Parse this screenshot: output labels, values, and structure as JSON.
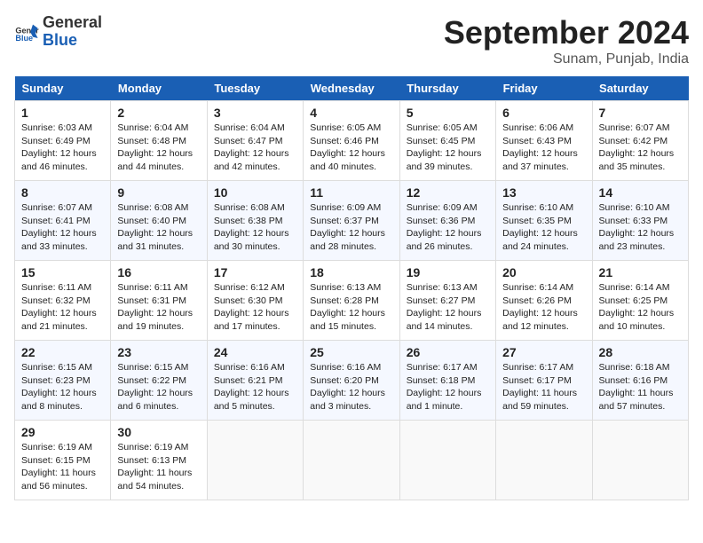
{
  "header": {
    "logo_line1": "General",
    "logo_line2": "Blue",
    "month": "September 2024",
    "location": "Sunam, Punjab, India"
  },
  "columns": [
    "Sunday",
    "Monday",
    "Tuesday",
    "Wednesday",
    "Thursday",
    "Friday",
    "Saturday"
  ],
  "weeks": [
    [
      {
        "day": "1",
        "info": "Sunrise: 6:03 AM\nSunset: 6:49 PM\nDaylight: 12 hours\nand 46 minutes."
      },
      {
        "day": "2",
        "info": "Sunrise: 6:04 AM\nSunset: 6:48 PM\nDaylight: 12 hours\nand 44 minutes."
      },
      {
        "day": "3",
        "info": "Sunrise: 6:04 AM\nSunset: 6:47 PM\nDaylight: 12 hours\nand 42 minutes."
      },
      {
        "day": "4",
        "info": "Sunrise: 6:05 AM\nSunset: 6:46 PM\nDaylight: 12 hours\nand 40 minutes."
      },
      {
        "day": "5",
        "info": "Sunrise: 6:05 AM\nSunset: 6:45 PM\nDaylight: 12 hours\nand 39 minutes."
      },
      {
        "day": "6",
        "info": "Sunrise: 6:06 AM\nSunset: 6:43 PM\nDaylight: 12 hours\nand 37 minutes."
      },
      {
        "day": "7",
        "info": "Sunrise: 6:07 AM\nSunset: 6:42 PM\nDaylight: 12 hours\nand 35 minutes."
      }
    ],
    [
      {
        "day": "8",
        "info": "Sunrise: 6:07 AM\nSunset: 6:41 PM\nDaylight: 12 hours\nand 33 minutes."
      },
      {
        "day": "9",
        "info": "Sunrise: 6:08 AM\nSunset: 6:40 PM\nDaylight: 12 hours\nand 31 minutes."
      },
      {
        "day": "10",
        "info": "Sunrise: 6:08 AM\nSunset: 6:38 PM\nDaylight: 12 hours\nand 30 minutes."
      },
      {
        "day": "11",
        "info": "Sunrise: 6:09 AM\nSunset: 6:37 PM\nDaylight: 12 hours\nand 28 minutes."
      },
      {
        "day": "12",
        "info": "Sunrise: 6:09 AM\nSunset: 6:36 PM\nDaylight: 12 hours\nand 26 minutes."
      },
      {
        "day": "13",
        "info": "Sunrise: 6:10 AM\nSunset: 6:35 PM\nDaylight: 12 hours\nand 24 minutes."
      },
      {
        "day": "14",
        "info": "Sunrise: 6:10 AM\nSunset: 6:33 PM\nDaylight: 12 hours\nand 23 minutes."
      }
    ],
    [
      {
        "day": "15",
        "info": "Sunrise: 6:11 AM\nSunset: 6:32 PM\nDaylight: 12 hours\nand 21 minutes."
      },
      {
        "day": "16",
        "info": "Sunrise: 6:11 AM\nSunset: 6:31 PM\nDaylight: 12 hours\nand 19 minutes."
      },
      {
        "day": "17",
        "info": "Sunrise: 6:12 AM\nSunset: 6:30 PM\nDaylight: 12 hours\nand 17 minutes."
      },
      {
        "day": "18",
        "info": "Sunrise: 6:13 AM\nSunset: 6:28 PM\nDaylight: 12 hours\nand 15 minutes."
      },
      {
        "day": "19",
        "info": "Sunrise: 6:13 AM\nSunset: 6:27 PM\nDaylight: 12 hours\nand 14 minutes."
      },
      {
        "day": "20",
        "info": "Sunrise: 6:14 AM\nSunset: 6:26 PM\nDaylight: 12 hours\nand 12 minutes."
      },
      {
        "day": "21",
        "info": "Sunrise: 6:14 AM\nSunset: 6:25 PM\nDaylight: 12 hours\nand 10 minutes."
      }
    ],
    [
      {
        "day": "22",
        "info": "Sunrise: 6:15 AM\nSunset: 6:23 PM\nDaylight: 12 hours\nand 8 minutes."
      },
      {
        "day": "23",
        "info": "Sunrise: 6:15 AM\nSunset: 6:22 PM\nDaylight: 12 hours\nand 6 minutes."
      },
      {
        "day": "24",
        "info": "Sunrise: 6:16 AM\nSunset: 6:21 PM\nDaylight: 12 hours\nand 5 minutes."
      },
      {
        "day": "25",
        "info": "Sunrise: 6:16 AM\nSunset: 6:20 PM\nDaylight: 12 hours\nand 3 minutes."
      },
      {
        "day": "26",
        "info": "Sunrise: 6:17 AM\nSunset: 6:18 PM\nDaylight: 12 hours\nand 1 minute."
      },
      {
        "day": "27",
        "info": "Sunrise: 6:17 AM\nSunset: 6:17 PM\nDaylight: 11 hours\nand 59 minutes."
      },
      {
        "day": "28",
        "info": "Sunrise: 6:18 AM\nSunset: 6:16 PM\nDaylight: 11 hours\nand 57 minutes."
      }
    ],
    [
      {
        "day": "29",
        "info": "Sunrise: 6:19 AM\nSunset: 6:15 PM\nDaylight: 11 hours\nand 56 minutes."
      },
      {
        "day": "30",
        "info": "Sunrise: 6:19 AM\nSunset: 6:13 PM\nDaylight: 11 hours\nand 54 minutes."
      },
      {
        "day": "",
        "info": ""
      },
      {
        "day": "",
        "info": ""
      },
      {
        "day": "",
        "info": ""
      },
      {
        "day": "",
        "info": ""
      },
      {
        "day": "",
        "info": ""
      }
    ]
  ]
}
